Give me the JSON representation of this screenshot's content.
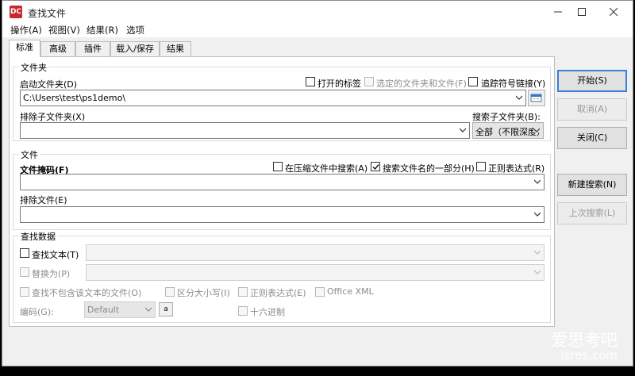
{
  "window": {
    "title": "查找文件",
    "icon_name": "app-logo-icon",
    "accent": "#3c7fd6"
  },
  "menu": [
    "操作(A)",
    "视图(V)",
    "结果(R)",
    "选项"
  ],
  "tabs": [
    "标准",
    "高级",
    "插件",
    "载入/保存",
    "结果"
  ],
  "folders": {
    "group_label": "文件夹",
    "start_label": "启动文件夹(D)",
    "start_value": "C:\\Users\\test\\ps1demo\\",
    "open_tabs": "打开的标签",
    "selected_files": "选定的文件夹和文件(F)",
    "follow_links": "追踪符号链接(Y)",
    "exclude_label": "排除子文件夹(X)",
    "exclude_value": "",
    "search_sub_label": "搜索子文件夹(B):",
    "search_sub_value": "全部（不限深度）"
  },
  "files": {
    "group_label": "文件",
    "mask_label": "文件掩码(F)",
    "mask_value": "",
    "in_archive": "在压缩文件中搜索(A)",
    "part_name": "搜索文件名的一部分(H)",
    "regex": "正则表达式(R)",
    "exclude_label": "排除文件(E)",
    "exclude_value": ""
  },
  "find_data": {
    "group_label": "查找数据",
    "find_text": "查找文本(T)",
    "replace_with": "替换为(P)",
    "not_contain": "查找不包含该文本的文件(O)",
    "case": "区分大小写(I)",
    "regex": "正则表达式(E)",
    "office_xml": "Office XML",
    "encoding_label": "编码(G):",
    "encoding_value": "Default",
    "hex": "十六进制"
  },
  "buttons": {
    "start": "开始(S)",
    "cancel": "取消(A)",
    "close": "关闭(C)",
    "new_search": "新建搜索(N)",
    "last_search": "上次搜索(L)"
  },
  "watermark": {
    "line1": "爱思考吧",
    "line2": "isres.com"
  }
}
